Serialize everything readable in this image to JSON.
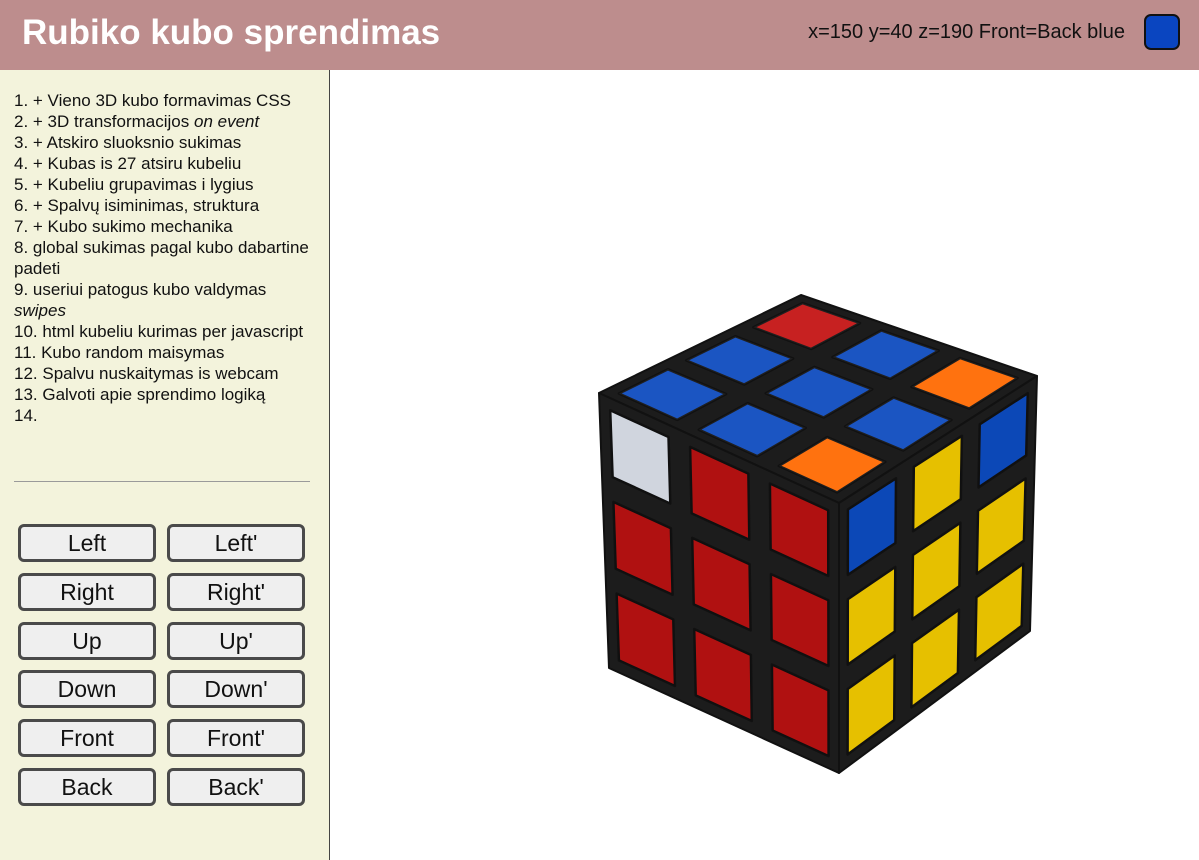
{
  "header": {
    "title": "Rubiko kubo sprendimas",
    "status": "x=150 y=40 z=190 Front=Back blue",
    "swatch_color": "#0a45c0"
  },
  "todo": [
    {
      "text": "1. + Vieno 3D kubo formavimas CSS"
    },
    {
      "text": "2. + 3D transformacijos ",
      "emph": "on event"
    },
    {
      "text": "3. + Atskiro sluoksnio sukimas"
    },
    {
      "text": "4. + Kubas is 27 atsiru kubeliu"
    },
    {
      "text": "5. + Kubeliu grupavimas i lygius"
    },
    {
      "text": "6. + Spalvų isiminimas, struktura"
    },
    {
      "text": "7. + Kubo sukimo mechanika"
    },
    {
      "text": "8. global sukimas pagal kubo dabartine padeti"
    },
    {
      "text": "9. useriui patogus kubo valdymas ",
      "emph": "swipes"
    },
    {
      "text": "10. html kubeliu kurimas per javascript"
    },
    {
      "text": "11. Kubo random maisymas"
    },
    {
      "text": "12. Spalvu nuskaitymas is webcam"
    },
    {
      "text": "13. Galvoti apie sprendimo logiką"
    },
    {
      "text": "14."
    }
  ],
  "controls": {
    "left": "Left",
    "left_prime": "Left'",
    "right": "Right",
    "right_prime": "Right'",
    "up": "Up",
    "up_prime": "Up'",
    "down": "Down",
    "down_prime": "Down'",
    "front": "Front",
    "front_prime": "Front'",
    "back": "Back",
    "back_prime": "Back'"
  },
  "colors": {
    "white": "#e8eef8",
    "red": "#c41414",
    "blue": "#0d4bbf",
    "yellow": "#f0c800",
    "orange": "#ff6a00"
  },
  "cube": {
    "top_face": [
      [
        "red",
        "blue",
        "orange"
      ],
      [
        "blue",
        "blue",
        "blue"
      ],
      [
        "blue",
        "blue",
        "orange"
      ]
    ],
    "left_face": [
      [
        "white",
        "red",
        "red"
      ],
      [
        "red",
        "red",
        "red"
      ],
      [
        "red",
        "red",
        "red"
      ]
    ],
    "right_face": [
      [
        "blue",
        "yellow",
        "blue"
      ],
      [
        "yellow",
        "yellow",
        "yellow"
      ],
      [
        "yellow",
        "yellow",
        "yellow"
      ]
    ]
  }
}
